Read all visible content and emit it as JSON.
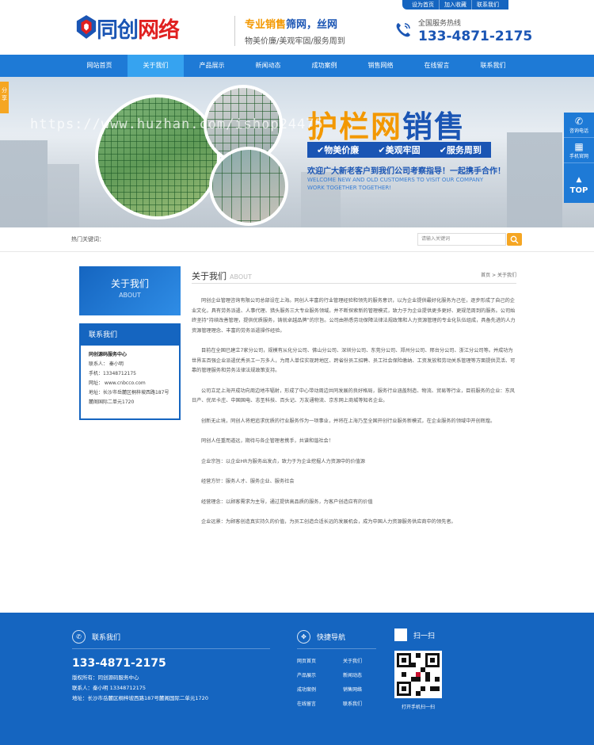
{
  "toplinks": [
    "设为首页",
    "加入收藏",
    "联系我们"
  ],
  "header": {
    "logo_text_a": "同创",
    "logo_text_b": "网络",
    "slogan_a": "专业销售",
    "slogan_b": "筛网，丝网",
    "slogan_sub": "物美价廉/美观牢固/服务周到",
    "hotline_label": "全国服务热线",
    "hotline_number": "133-4871-2175"
  },
  "nav": [
    "网站首页",
    "关于我们",
    "产品展示",
    "新闻动态",
    "成功案例",
    "销售网络",
    "在线留言",
    "联系我们"
  ],
  "nav_active_index": 1,
  "banner": {
    "title_a": "护栏网",
    "title_b": "销售",
    "tags": [
      "✔物美价廉",
      "✔美观牢固",
      "✔服务周到"
    ],
    "welcome": "欢迎广大新老客户到我们公司考察指导！一起携手合作！",
    "welcome_en": "WELCOME NEW AND OLD CUSTOMERS TO VISIT OUR COMPANY WORK TOGETHER TOGETHER!",
    "watermark": "https://www.huzhan.com/ishop24475"
  },
  "float_share": "分享",
  "float_side": [
    "咨询电话",
    "手机官网",
    "TOP"
  ],
  "search": {
    "hot_label": "热门关键词：",
    "placeholder": "请输入关键词"
  },
  "left": {
    "about_title": "关于我们",
    "about_en": "ABOUT",
    "contact_title": "联系我们",
    "company": "同创源码服务中心",
    "lines": [
      "联系人： 秦小明",
      "手机：13348712175",
      "网址： www.cnbcco.com",
      "地址：长沙市岳麓区桐梓坡西路187号麓阁国际二单元1720"
    ]
  },
  "content": {
    "title": "关于我们",
    "title_en": "ABOUT",
    "crumb": "首页 > 关于我们",
    "paras": [
      "同创企业管理咨询有限公司总部设在上海。同创人丰富的行业管理经验和领先的服务意识，以为企业提供最好化服务为己任，逐步形成了自己的企业文化，具有劳务派遣、人事代理、猎头服务三大专业服务领域。并不断探索新的管理模式，致力于为企业提供更多更好、更规范周到的服务。公司始终坚持“持续改善管理，提供优质服务，铸就卓越品牌”的宗旨。公司由熟悉劳动保障法律法规政策和人力资源管理的专业化队伍组成，具备先进的人力资源管理理念、丰富的劳务派遣操作经验。",
      "目前在全国已建立7家分公司，规模有从化分公司、佛山分公司、深圳分公司、东莞分公司、郑州分公司、邢台分公司、浙江分公司等。并成功为世界五百强企业派遣优秀员工一万多人，为用人单位实现跨地区、跨省份员工招聘、员工社会保险缴纳、工资发放和劳动关系管理等方面提供灵活、可靠的管理服务和劳务法律法规政策支持。",
      "公司立足上海开成功向周边地市辐射，形成了中心带动周边共同发展的良好格局，服务行业涵盖制造、物流、贸易等行业，目前服务的企业：东风日产、优尼卡庄、中国国电、志圣科技、百头记、万友通物流、京东网上商城等知名企业。",
      "创新无止境，同创人将把追求优质的行业服务作为一项事业，并将在上海乃至全国开创行业服务新模式，在企业服务的领域中开创辉煌。",
      "同创人任重而道远，期待与各企管理者携手，共谱和谐社会！",
      "企业宗旨：以企业HR为服务出发点，致力于为企业挖掘人力资源中的价值源",
      "经营方针：服务人才、服务企业、服务社会",
      "经营理念：以顾客需求为主导，通过提供高品质的服务，为客户创造应有的价值",
      "企业远景：为顾客创造真实持久的价值，为员工创造合适长远的发展机会，成为中国人力资源服务供应商中的领先者。"
    ]
  },
  "footer": {
    "contact_title": "联系我们",
    "phone": "133-4871-2175",
    "lines": [
      "版权所有：同创源码服务中心",
      "联系人：秦小明 13348712175",
      "地址：长沙市岳麓区桐梓坡西路187号麓阁国际二单元1720"
    ],
    "quick_title": "快捷导航",
    "quick_links": [
      "网页首页",
      "关于我们",
      "产品展示",
      "新闻动态",
      "成功案例",
      "销售网络",
      "在线留言",
      "联系我们"
    ],
    "scan_title": "扫一扫",
    "scan_caption": "打开手机扫一扫"
  },
  "colors": {
    "brand_blue": "#1565c0",
    "nav_blue": "#1e7ad6",
    "accent_orange": "#f39800"
  }
}
